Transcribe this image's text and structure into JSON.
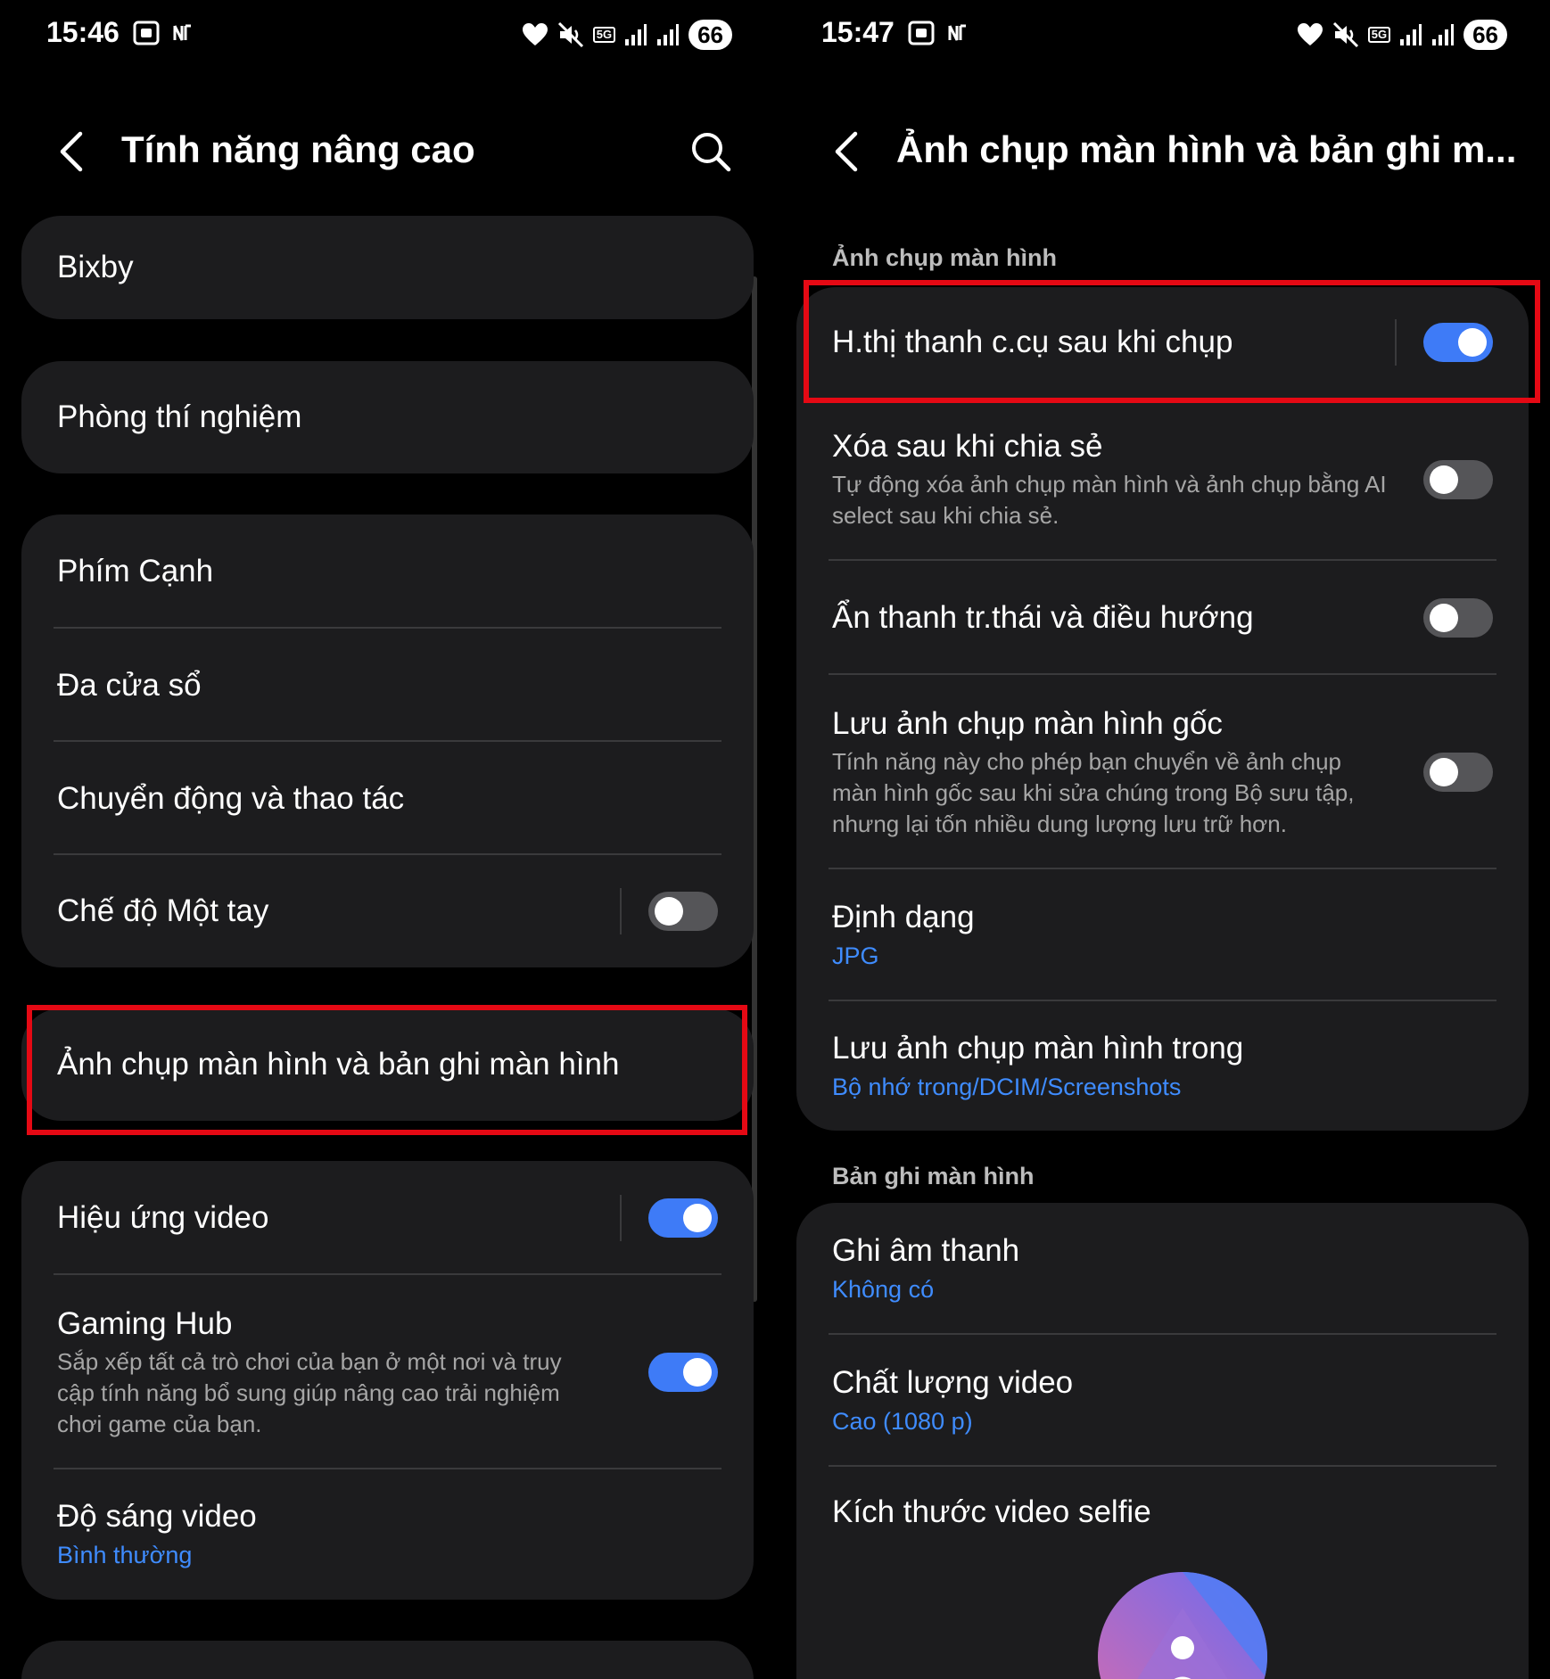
{
  "left": {
    "status": {
      "time": "15:46",
      "battery": "66"
    },
    "header": {
      "title": "Tính năng nâng cao"
    },
    "items": {
      "bixby": "Bixby",
      "labs": "Phòng thí nghiệm",
      "side_key": "Phím Cạnh",
      "multi_window": "Đa cửa sổ",
      "motions": "Chuyển động và thao tác",
      "one_hand": "Chế độ Một tay",
      "screenshots": "Ảnh chụp màn hình và bản ghi màn hình",
      "video_effects": "Hiệu ứng video",
      "gaming_hub": "Gaming Hub",
      "gaming_hub_desc": "Sắp xếp tất cả trò chơi của bạn ở một nơi và truy cập tính năng bổ sung giúp nâng cao trải nghiệm chơi game của bạn.",
      "video_brightness": "Độ sáng video",
      "video_brightness_value": "Bình thường"
    },
    "toggles": {
      "one_hand": false,
      "video_effects": true,
      "gaming_hub": true
    }
  },
  "right": {
    "status": {
      "time": "15:47",
      "battery": "66"
    },
    "header": {
      "title": "Ảnh chụp màn hình và bản ghi m..."
    },
    "section_screenshot": "Ảnh chụp màn hình",
    "items": {
      "toolbar": "H.thị thanh c.cụ sau khi chụp",
      "delete_after_share": "Xóa sau khi chia sẻ",
      "delete_after_share_desc": "Tự động xóa ảnh chụp màn hình và ảnh chụp bằng AI select sau khi chia sẻ.",
      "hide_bars": "Ẩn thanh tr.thái và điều hướng",
      "save_original": "Lưu ảnh chụp màn hình gốc",
      "save_original_desc": "Tính năng này cho phép bạn chuyển về ảnh chụp màn hình gốc sau khi sửa chúng trong Bộ sưu tập, nhưng lại tốn nhiều dung lượng lưu trữ hơn.",
      "format": "Định dạng",
      "format_value": "JPG",
      "save_in": "Lưu ảnh chụp màn hình trong",
      "save_in_value": "Bộ nhớ trong/DCIM/Screenshots",
      "sound": "Ghi âm thanh",
      "sound_value": "Không có",
      "quality": "Chất lượng video",
      "quality_value": "Cao (1080 p)",
      "selfie_size": "Kích thước video selfie"
    },
    "section_recording": "Bản ghi màn hình",
    "toggles": {
      "toolbar": true,
      "delete_after_share": false,
      "hide_bars": false,
      "save_original": false
    }
  },
  "colors": {
    "accent": "#3e7bf7",
    "link": "#3f8cff",
    "highlight": "#e50914",
    "card": "#1c1c1e"
  }
}
